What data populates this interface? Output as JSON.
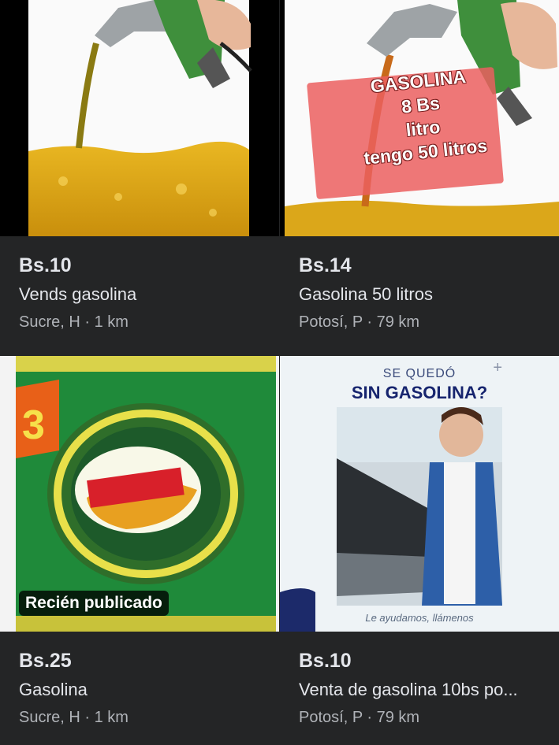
{
  "listings": [
    {
      "price": "Bs.10",
      "title": "Vends gasolina",
      "location": "Sucre, H · 1 km",
      "image": "fuel-pour-photo"
    },
    {
      "price": "Bs.14",
      "title": "Gasolina 50 litros",
      "location": "Potosí, P · 79 km",
      "image": "fuel-pour-photo-with-sign",
      "sign_lines": [
        "GASOLINA",
        "8 Bs",
        "litro",
        "tengo 50 litros"
      ]
    },
    {
      "price": "Bs.25",
      "title": "Gasolina",
      "location": "Sucre, H · 1 km",
      "image": "salvietti-can-photo",
      "badge": "Recién publicado"
    },
    {
      "price": "Bs.10",
      "title": "Venta de gasolina 10bs po...",
      "location": "Potosí, P · 79 km",
      "image": "roadside-assistance-ad",
      "ad_top": "SE QUEDÓ",
      "ad_main": "SIN GASOLINA?",
      "ad_caption": "Le ayudamos, llámenos"
    }
  ],
  "colors": {
    "background": "#242526",
    "primary_text": "#e4e6eb",
    "secondary_text": "#b0b3b8"
  }
}
